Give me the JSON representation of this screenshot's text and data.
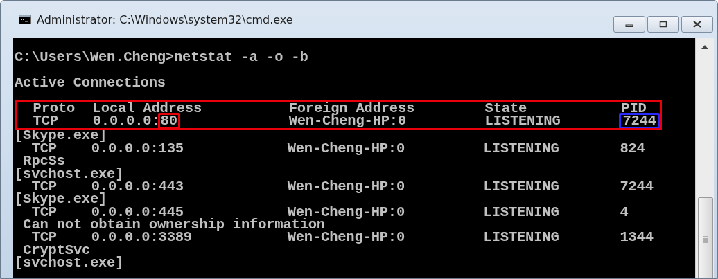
{
  "window": {
    "title": "Administrator: C:\\Windows\\system32\\cmd.exe"
  },
  "console": {
    "command_line": "C:\\Users\\Wen.Cheng>netstat -a -o -b",
    "heading": "Active Connections",
    "columns": [
      "Proto",
      "Local Address",
      "Foreign Address",
      "State",
      "PID"
    ],
    "header_boxed": true,
    "connections": [
      {
        "proto": "TCP",
        "local_host": "0.0.0.0:",
        "local_port": "80",
        "foreign": "Wen-Cheng-HP:0",
        "state": "LISTENING",
        "pid": "7244",
        "highlighted": true,
        "owner": [
          {
            "kind": "process",
            "text": "[Skype.exe]"
          }
        ]
      },
      {
        "proto": "TCP",
        "local_host": "0.0.0.0:",
        "local_port": "135",
        "foreign": "Wen-Cheng-HP:0",
        "state": "LISTENING",
        "pid": "824",
        "highlighted": false,
        "owner": [
          {
            "kind": "service",
            "text": "RpcSs"
          },
          {
            "kind": "process",
            "text": "[svchost.exe]"
          }
        ]
      },
      {
        "proto": "TCP",
        "local_host": "0.0.0.0:",
        "local_port": "443",
        "foreign": "Wen-Cheng-HP:0",
        "state": "LISTENING",
        "pid": "7244",
        "highlighted": false,
        "owner": [
          {
            "kind": "process",
            "text": "[Skype.exe]"
          }
        ]
      },
      {
        "proto": "TCP",
        "local_host": "0.0.0.0:",
        "local_port": "445",
        "foreign": "Wen-Cheng-HP:0",
        "state": "LISTENING",
        "pid": "4",
        "highlighted": false,
        "owner": [
          {
            "kind": "service",
            "text": "Can not obtain ownership information"
          }
        ]
      },
      {
        "proto": "TCP",
        "local_host": "0.0.0.0:",
        "local_port": "3389",
        "foreign": "Wen-Cheng-HP:0",
        "state": "LISTENING",
        "pid": "1344",
        "highlighted": false,
        "owner": [
          {
            "kind": "service",
            "text": "CryptSvc"
          },
          {
            "kind": "process",
            "text": "[svchost.exe]"
          }
        ]
      }
    ]
  }
}
